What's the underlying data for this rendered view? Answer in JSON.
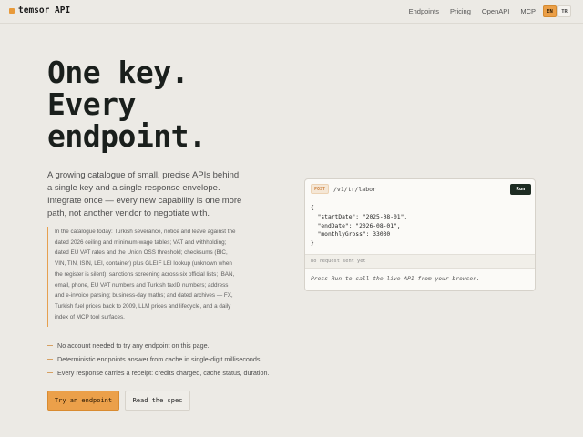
{
  "nav": {
    "brand": "temsor API",
    "links": [
      "Endpoints",
      "Pricing",
      "OpenAPI",
      "MCP"
    ],
    "languages": [
      "EN",
      "TR"
    ],
    "active_language": "EN"
  },
  "hero": {
    "lines": [
      "One key.",
      "Every",
      "endpoint."
    ],
    "lead": "A growing catalogue of small, precise APIs behind a single key and a single response envelope. Integrate once — every new capability is one more path, not another vendor to negotiate with.",
    "catalog": "In the catalogue today: Turkish severance, notice and leave against the dated 2026 ceiling and minimum-wage tables; VAT and withholding; dated EU VAT rates and the Union OSS threshold; checksums (BIC, VIN, TIN, ISIN, LEI, container) plus GLEIF LEI lookup (unknown when the register is silent); sanctions screening across six official lists; IBAN, email, phone, EU VAT numbers and Turkish taxID numbers; address and e-invoice parsing; business-day maths; and dated archives — FX, Turkish fuel prices back to 2009, LLM prices and lifecycle, and a daily index of MCP tool surfaces.",
    "features": [
      "No account needed to try any endpoint on this page.",
      "Deterministic endpoints answer from cache in single-digit milliseconds.",
      "Every response carries a receipt: credits charged, cache status, duration."
    ],
    "primary_cta": "Try an endpoint",
    "secondary_cta": "Read the spec"
  },
  "console": {
    "method": "POST",
    "path": "/v1/tr/labor",
    "run_label": "Run",
    "request_body": "{\n  \"startDate\": \"2025-08-01\",\n  \"endDate\": \"2026-08-01\",\n  \"monthlyGross\": 33030\n}",
    "status": "no request sent yet",
    "response_placeholder": "Press Run to call the live API from your browser."
  },
  "colors": {
    "accent": "#eba04a",
    "background": "#eceae5",
    "run_button": "#1d2b22"
  }
}
